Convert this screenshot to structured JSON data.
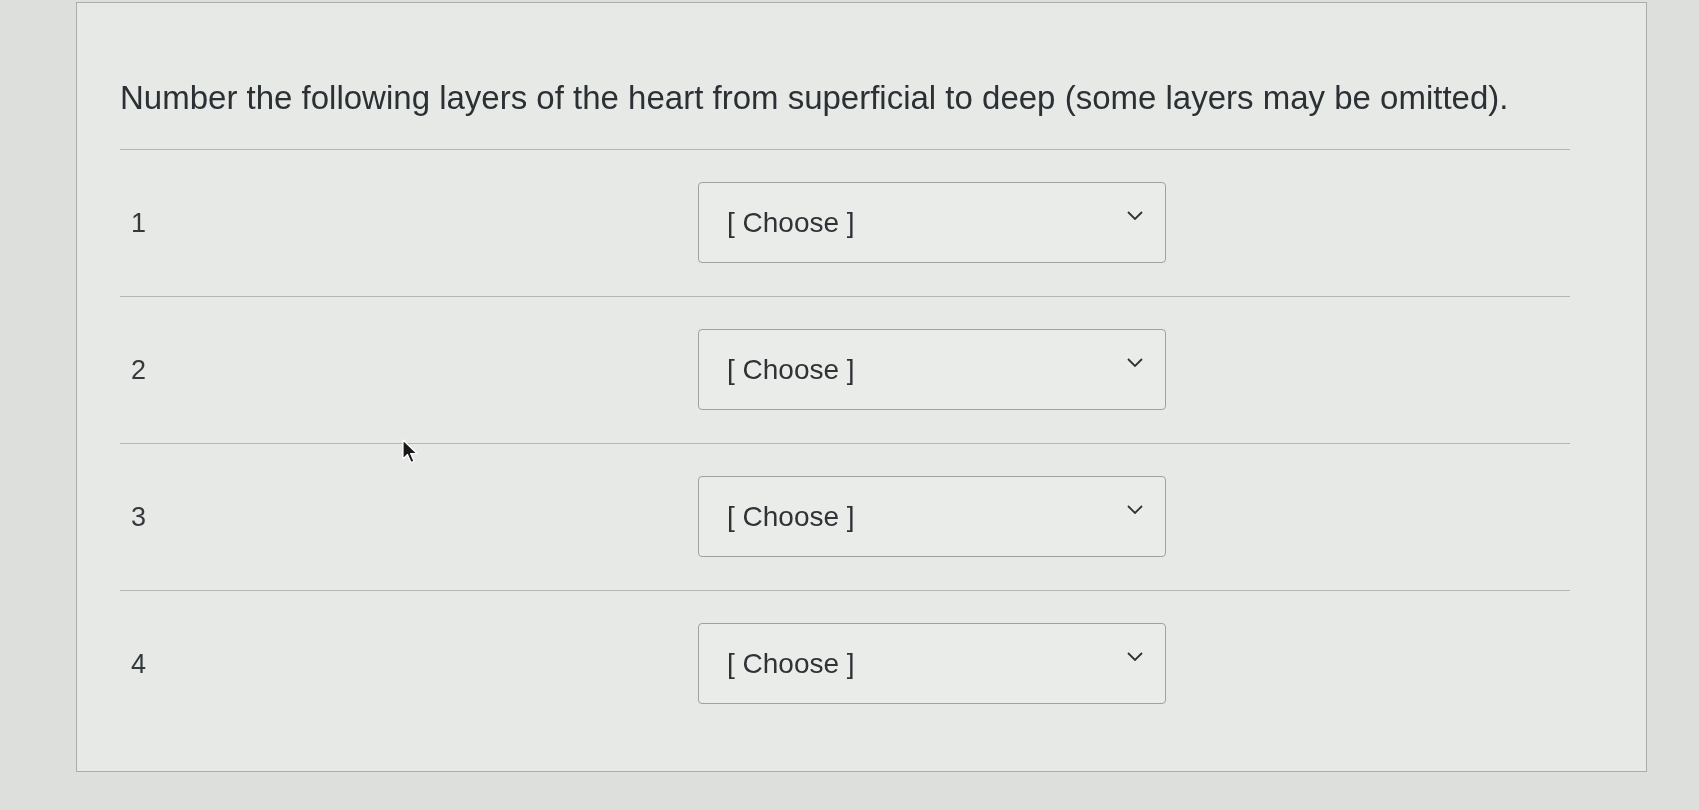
{
  "question": {
    "text": "Number the following layers of the heart from superficial to deep (some layers may be omitted)."
  },
  "rows": [
    {
      "label": "1",
      "dropdown": {
        "value": "[ Choose ]"
      }
    },
    {
      "label": "2",
      "dropdown": {
        "value": "[ Choose ]"
      }
    },
    {
      "label": "3",
      "dropdown": {
        "value": "[ Choose ]"
      }
    },
    {
      "label": "4",
      "dropdown": {
        "value": "[ Choose ]"
      }
    }
  ]
}
